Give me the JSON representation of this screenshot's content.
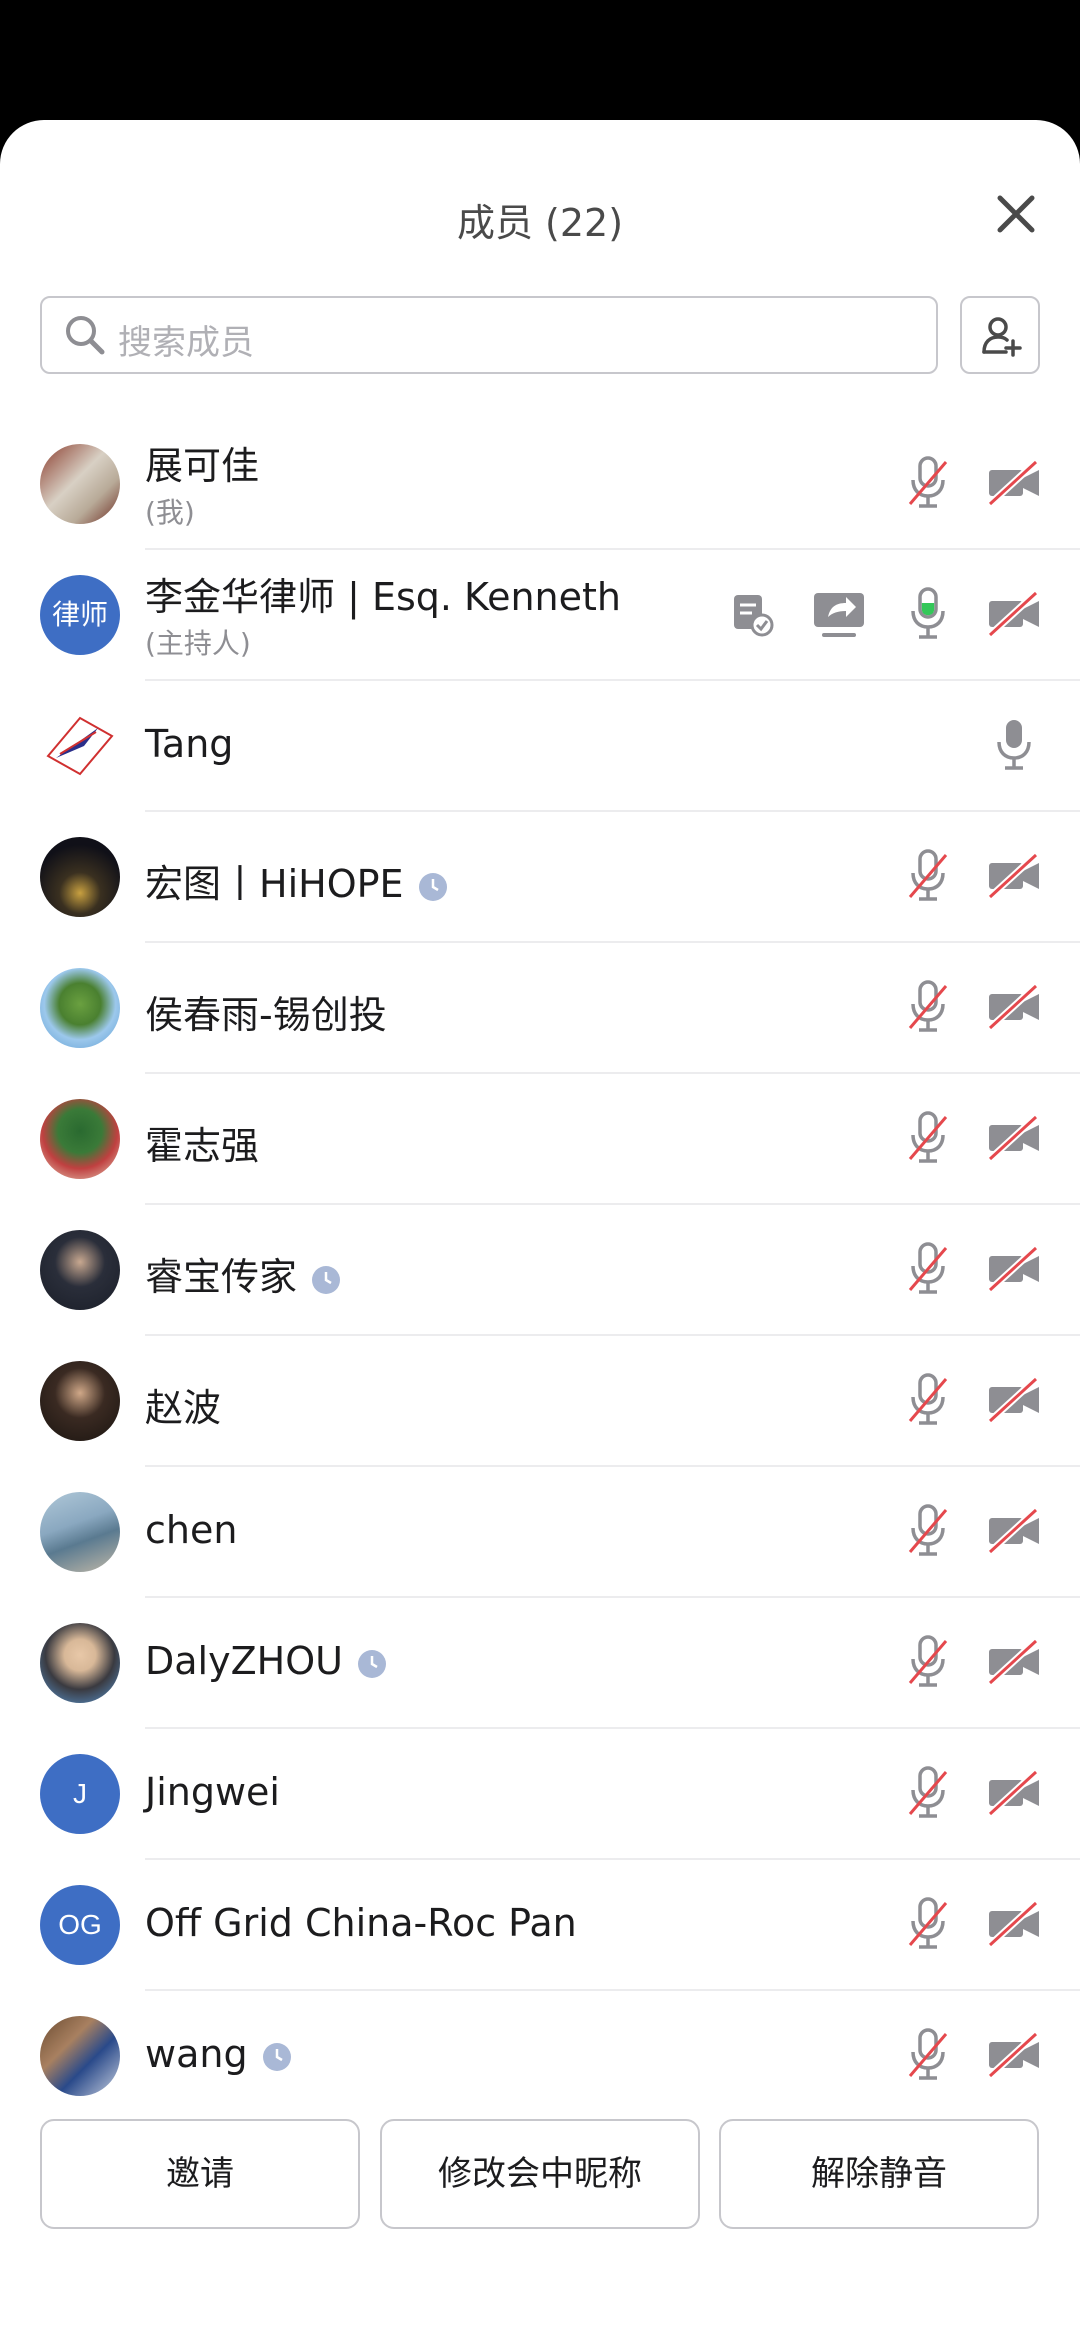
{
  "header": {
    "title": "成员 (22)"
  },
  "search": {
    "placeholder": "搜索成员"
  },
  "members": [
    {
      "name": "展可佳",
      "role": "(我)",
      "avatar": "photo",
      "clock": false,
      "mic": "off",
      "cam": "off"
    },
    {
      "name": "李金华律师 | Esq. Kenneth",
      "role": "(主持人)",
      "avatar_text": "律师",
      "avatar_color": "#3e6ec4",
      "clock": false,
      "mic": "on",
      "cam": "off",
      "extra_icons": [
        "document-share-icon",
        "screen-share-icon"
      ]
    },
    {
      "name": "Tang",
      "avatar": "logo",
      "clock": false,
      "mic": "on-gray",
      "cam": "none"
    },
    {
      "name": "宏图丨HiHOPE",
      "avatar": "photo",
      "clock": true,
      "mic": "off",
      "cam": "off"
    },
    {
      "name": "侯春雨-锡创投",
      "avatar": "photo",
      "clock": false,
      "mic": "off",
      "cam": "off"
    },
    {
      "name": "霍志强",
      "avatar": "photo",
      "clock": false,
      "mic": "off",
      "cam": "off"
    },
    {
      "name": "睿宝传家",
      "avatar": "photo",
      "clock": true,
      "mic": "off",
      "cam": "off"
    },
    {
      "name": "赵波",
      "avatar": "photo",
      "clock": false,
      "mic": "off",
      "cam": "off"
    },
    {
      "name": "chen",
      "avatar": "photo",
      "clock": false,
      "mic": "off",
      "cam": "off"
    },
    {
      "name": "DalyZHOU",
      "avatar": "photo",
      "clock": true,
      "mic": "off",
      "cam": "off"
    },
    {
      "name": "Jingwei",
      "avatar_text": "J",
      "avatar_color": "#3e6ec4",
      "clock": false,
      "mic": "off",
      "cam": "off"
    },
    {
      "name": "Off Grid China-Roc Pan",
      "avatar_text": "OG",
      "avatar_color": "#3e6ec4",
      "clock": false,
      "mic": "off",
      "cam": "off"
    },
    {
      "name": "wang",
      "avatar": "photo",
      "clock": true,
      "mic": "off",
      "cam": "off"
    }
  ],
  "footer": {
    "invite": "邀请",
    "rename": "修改会中昵称",
    "unmute": "解除静音"
  },
  "colors": {
    "accent": "#3e6ec4",
    "mute_red": "#e5484d",
    "icon_gray": "#8e8e93",
    "active_green": "#34c759"
  }
}
